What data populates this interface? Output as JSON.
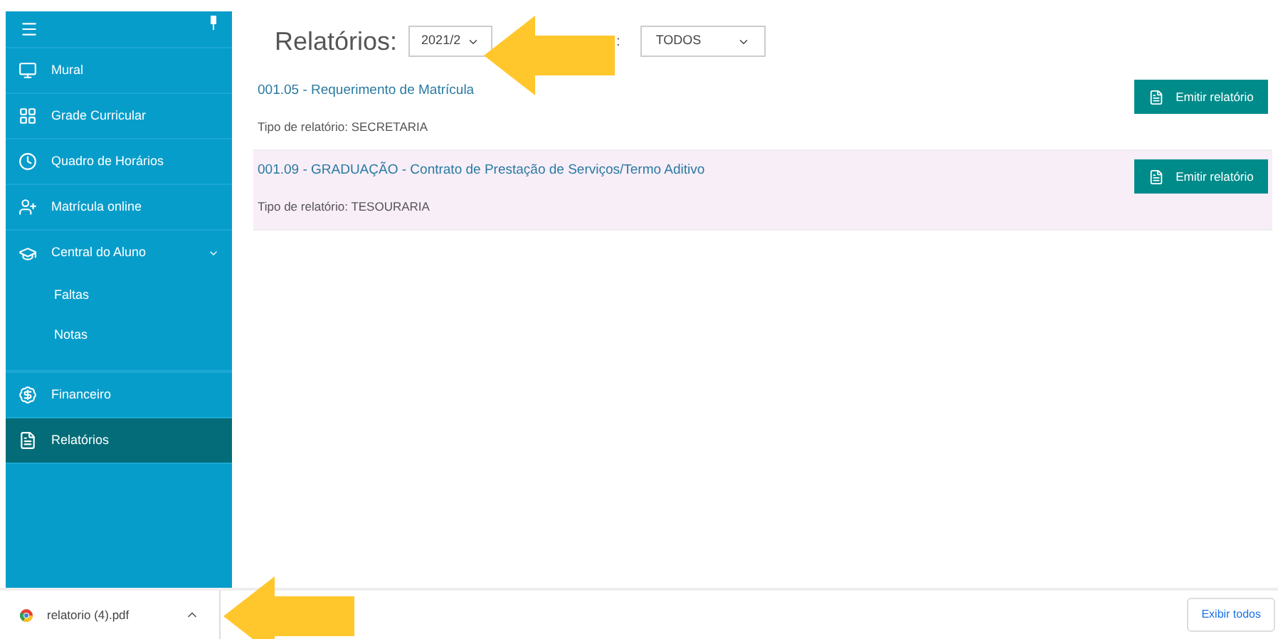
{
  "sidebar": {
    "items": [
      {
        "kind": "item",
        "label": "Mural",
        "selected": false
      },
      {
        "kind": "item",
        "label": "Grade Curricular",
        "selected": false
      },
      {
        "kind": "item",
        "label": "Quadro de Horários",
        "selected": false
      },
      {
        "kind": "item",
        "label": "Matrícula online",
        "selected": false
      },
      {
        "kind": "group",
        "label": "Central do Aluno",
        "expanded": true,
        "children": [
          {
            "label": "Faltas"
          },
          {
            "label": "Notas"
          }
        ]
      },
      {
        "kind": "item",
        "label": "Financeiro",
        "selected": false
      },
      {
        "kind": "item",
        "label": "Relatórios",
        "selected": true
      }
    ]
  },
  "header": {
    "title": "Relatórios:",
    "period_select": "2021/2",
    "filter_label": ":",
    "filter_select": "TODOS"
  },
  "reports": [
    {
      "title": "001.05 - Requerimento de Matrícula",
      "type_label": "Tipo de relatório:",
      "type": "SECRETARIA",
      "button": "Emitir relatório",
      "highlighted": false
    },
    {
      "title": "001.09 - GRADUAÇÃO - Contrato de Prestação de Serviços/Termo Aditivo",
      "type_label": "Tipo de relatório:",
      "type": "TESOURARIA",
      "button": "Emitir relatório",
      "highlighted": true
    }
  ],
  "download_bar": {
    "file": "relatorio (4).pdf",
    "show_all": "Exibir todos"
  }
}
